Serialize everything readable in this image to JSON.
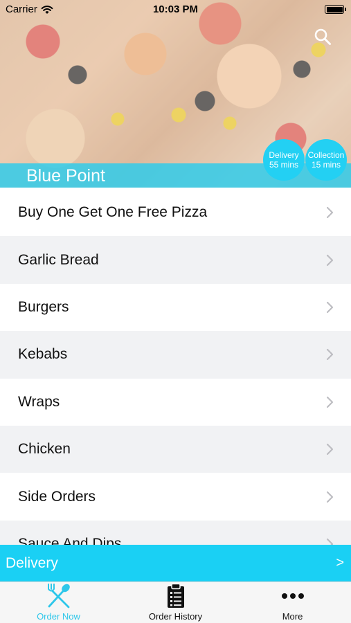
{
  "status_bar": {
    "carrier": "Carrier",
    "time": "10:03 PM",
    "icons": [
      "wifi-icon",
      "battery-icon"
    ]
  },
  "header": {
    "restaurant_name": "Blue Point",
    "search_icon": "search-icon",
    "delivery_badge": {
      "label": "Delivery",
      "time": "55 mins"
    },
    "collection_badge": {
      "label": "Collection",
      "time": "15 mins"
    }
  },
  "menu": {
    "items": [
      {
        "label": "Buy One Get One Free Pizza"
      },
      {
        "label": "Garlic Bread"
      },
      {
        "label": "Burgers"
      },
      {
        "label": "Kebabs"
      },
      {
        "label": "Wraps"
      },
      {
        "label": "Chicken"
      },
      {
        "label": "Side Orders"
      },
      {
        "label": "Sauce And Dips"
      }
    ],
    "chevron_icon": "chevron-right-icon"
  },
  "delivery_bar": {
    "label": "Delivery",
    "arrow": ">"
  },
  "tab_bar": {
    "tabs": [
      {
        "label": "Order Now",
        "icon": "fork-spoon-icon",
        "active": true
      },
      {
        "label": "Order History",
        "icon": "clipboard-icon",
        "active": false
      },
      {
        "label": "More",
        "icon": "ellipsis-icon",
        "active": false
      }
    ]
  },
  "colors": {
    "accent": "#1ad0f4",
    "badge": "#23d0f3",
    "active_tab": "#2ec7ea"
  }
}
